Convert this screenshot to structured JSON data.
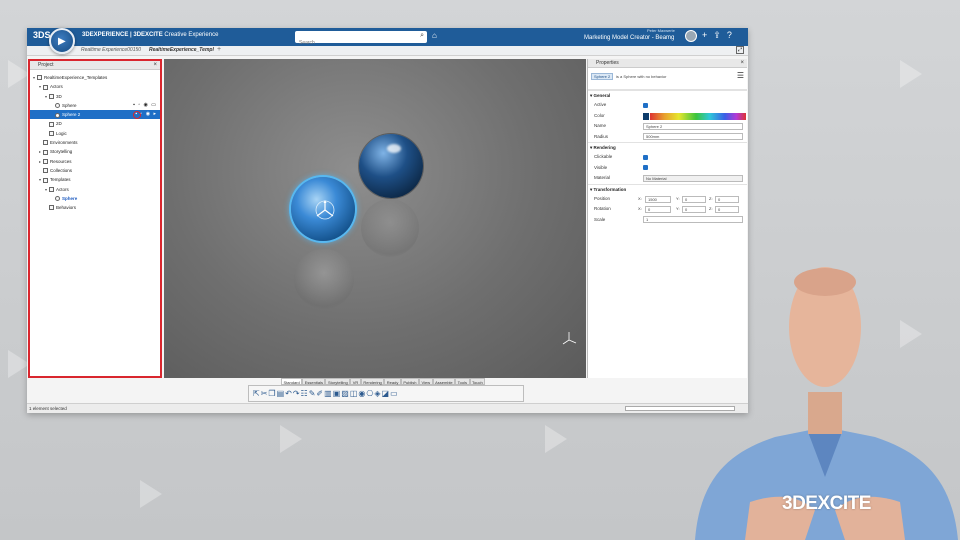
{
  "topbar": {
    "logo": "3DS",
    "brand_strong": "3DEXPERIENCE | 3DEXCITE",
    "brand_sub": "Creative Experience",
    "search_placeholder": "Search",
    "user_line": "Peter Maxwerie",
    "app_name": "Marketing Model Creator - Beamg"
  },
  "tabs": [
    {
      "label": "Realtime Experience00150"
    },
    {
      "label": "RealtimeExperience_Templ"
    }
  ],
  "project_panel": {
    "title": "Project",
    "tree": [
      {
        "label": "RealtimeExperience_Templates",
        "indent": 0,
        "arrow": "▾"
      },
      {
        "label": "Actors",
        "indent": 1,
        "arrow": "▾"
      },
      {
        "label": "3D",
        "indent": 2,
        "arrow": "▾"
      },
      {
        "label": "Sphere",
        "indent": 3,
        "arrow": ""
      },
      {
        "label": "Sphere 2",
        "indent": 3,
        "arrow": "",
        "selected": true
      },
      {
        "label": "2D",
        "indent": 2,
        "arrow": ""
      },
      {
        "label": "Logic",
        "indent": 2,
        "arrow": ""
      },
      {
        "label": "Environments",
        "indent": 1,
        "arrow": ""
      },
      {
        "label": "Storytelling",
        "indent": 1,
        "arrow": "▸"
      },
      {
        "label": "Resources",
        "indent": 1,
        "arrow": "▸"
      },
      {
        "label": "Collections",
        "indent": 1,
        "arrow": ""
      },
      {
        "label": "Templates",
        "indent": 1,
        "arrow": "▾"
      },
      {
        "label": "Actors",
        "indent": 2,
        "arrow": "▾"
      },
      {
        "label": "Sphere",
        "indent": 3,
        "arrow": "",
        "highlight": true
      },
      {
        "label": "Behaviors",
        "indent": 2,
        "arrow": ""
      }
    ]
  },
  "properties_panel": {
    "title": "Properties",
    "object_tag": "Sphere 2",
    "object_desc": "is a Sphere with no behavior",
    "sections": {
      "general": "General",
      "rendering": "Rendering",
      "transformation": "Transformation"
    },
    "general": {
      "active_label": "Active",
      "color_label": "Color",
      "name_label": "Name",
      "name_value": "Sphere 2",
      "radius_label": "Radius",
      "radius_value": "500mm"
    },
    "rendering": {
      "clickable_label": "Clickable",
      "visible_label": "Visible",
      "material_label": "Material",
      "material_value": "No Material"
    },
    "transformation": {
      "position_label": "Position",
      "rotation_label": "Rotation",
      "scale_label": "Scale",
      "position": {
        "x": "1500",
        "y": "0",
        "z": "0"
      },
      "rotation": {
        "x": "0",
        "y": "0",
        "z": "0"
      },
      "scale": "1",
      "x_label": "X:",
      "y_label": "Y:",
      "z_label": "Z:"
    }
  },
  "toolbar": {
    "tabs": [
      "Standard",
      "Essentials",
      "Storytelling",
      "VR",
      "Rendering",
      "Ready",
      "Publish",
      "View",
      "Assemble",
      "Tools",
      "Touch"
    ],
    "active_tab": "Standard"
  },
  "status": {
    "text": "1 element selected"
  },
  "watermark": {
    "logo": "3DEXCITE"
  },
  "colors": {
    "topbar": "#1f5c99",
    "selection": "#1f6fc6",
    "highlight_border": "#d9262e",
    "sphere_color": "#0d3c6b"
  }
}
